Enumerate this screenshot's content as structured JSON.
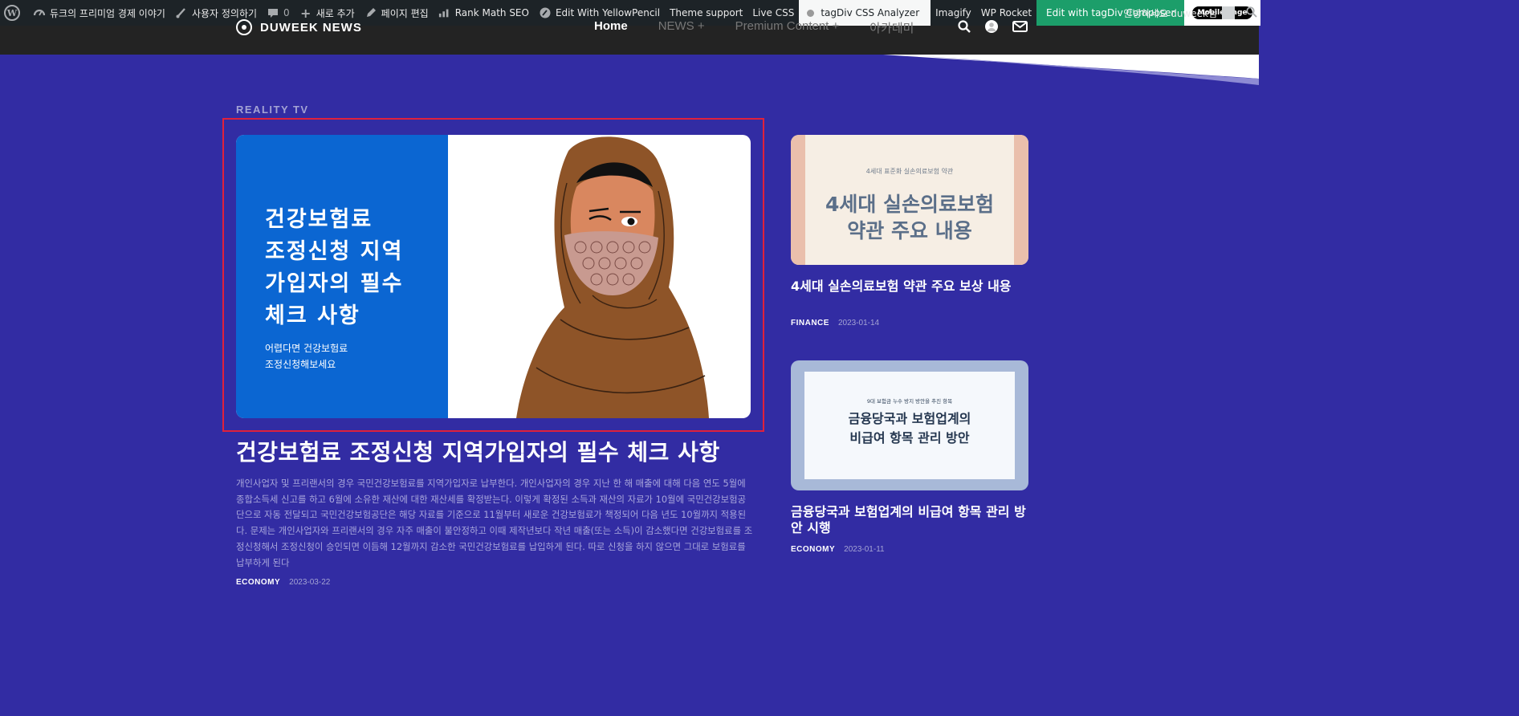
{
  "adminbar": {
    "site_name": "듀크의 프리미엄 경제 이야기",
    "customize": "사용자 정의하기",
    "comments_count": "0",
    "add_new": "새로 추가",
    "edit_page": "페이지 편집",
    "rank_math": "Rank Math SEO",
    "yellowpencil": "Edit With YellowPencil",
    "theme_support": "Theme support",
    "live_css": "Live CSS",
    "tagdiv_analyzer": "tagDiv CSS Analyzer",
    "imagify": "Imagify",
    "wp_rocket": "WP Rocket",
    "tagdiv_composer": "Edit with tagDiv Composer",
    "mobile_page": "Mobile page",
    "greeting": "안녕하세요 duweek님"
  },
  "header": {
    "logo_text": "DUWEEK NEWS",
    "nav": [
      "Home",
      "NEWS  +",
      "Premium Content  +",
      "아카데미"
    ]
  },
  "main": {
    "category": "REALITY TV",
    "image_title_lines": [
      "건강보험료",
      "조정신청 지역",
      "가입자의 필수",
      "체크 사항"
    ],
    "image_sub_lines": [
      "어렵다면 건강보험료",
      "조정신청해보세요"
    ],
    "title": "건강보험료 조정신청 지역가입자의 필수 체크 사항",
    "excerpt": "개인사업자 및 프리랜서의 경우 국민건강보험료를 지역가입자로 납부한다. 개인사업자의 경우 지난 한 해 매출에 대해 다음 연도 5월에 종합소득세 신고를 하고 6월에 소유한 재산에 대한 재산세를 확정받는다. 이렇게 확정된 소득과 재산의 자료가 10월에 국민건강보험공단으로 자동 전달되고 국민건강보험공단은 해당 자료를 기준으로 11월부터 새로운 건강보험료가 책정되어 다음 년도 10월까지 적용된다. 문제는 개인사업자와 프리랜서의 경우 자주 매출이 불안정하고 이때 제작년보다 작년 매출(또는 소득)이 감소했다면 건강보험료를 조정신청해서 조정신청이 승인되면 이듬해 12월까지 감소한 국민건강보험료를 납입하게 된다. 따로 신청을 하지 않으면 그대로 보험료를 납부하게 된다",
    "meta_category": "ECONOMY",
    "meta_date": "2023-03-22"
  },
  "side": [
    {
      "image_sub": "4세대 표준화 실손의료보험 약관",
      "image_lines": [
        "4세대 실손의료보험",
        "약관 주요 내용"
      ],
      "title": "4세대 실손의료보험 약관 주요 보상 내용",
      "category": "FINANCE",
      "date": "2023-01-14"
    },
    {
      "image_sub": "9대 보험금 누수 방지 방안을 추진 항목",
      "image_lines": [
        "금융당국과 보험업계의",
        "비급여 항목 관리 방안"
      ],
      "title": "금융당국과 보험업계의 비급여 항목 관리 방안 시행",
      "category": "ECONOMY",
      "date": "2023-01-11"
    }
  ],
  "colors": {
    "page_bg": "#322ca3",
    "adminbar_bg": "#1d2327",
    "highlight_border": "#e0213b",
    "image_blue": "#0b66d2"
  }
}
